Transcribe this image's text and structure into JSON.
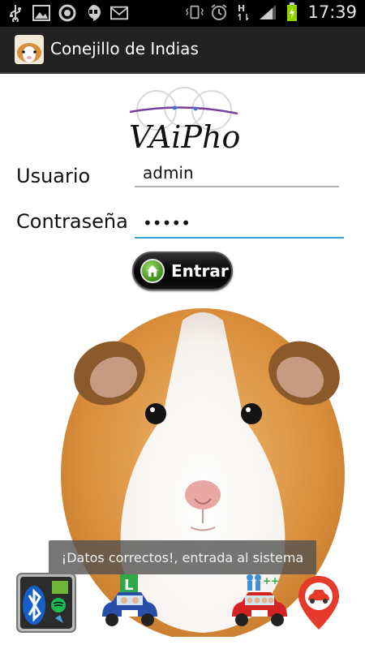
{
  "status_bar": {
    "time": "17:39",
    "icons": [
      "usb-icon",
      "picture-icon",
      "firefox-icon",
      "hangouts-icon",
      "gmail-icon",
      "vibrate-icon",
      "alarm-icon",
      "data-h-icon",
      "signal-icon",
      "battery-charging-icon"
    ]
  },
  "action_bar": {
    "title": "Conejillo de Indias",
    "icon": "guinea-pig-app-icon"
  },
  "logo": {
    "text": "VAiPho"
  },
  "form": {
    "user_label": "Usuario",
    "user_value": "admin",
    "password_label": "Contraseña",
    "password_value": "•••••"
  },
  "button": {
    "label": "Entrar",
    "icon": "home-icon"
  },
  "toast": {
    "message": "¡Datos correctos!, entrada al sistema"
  },
  "bottom_icons": [
    "bluetooth-apps-icon",
    "driving-school-car-icon",
    "carpool-car-icon",
    "car-location-pin-icon"
  ],
  "colors": {
    "status_bar_bg": "#000000",
    "action_bar_bg": "#222222",
    "focus_line": "#33a3d4",
    "button_bg": "#000000",
    "home_icon_green": "#3e8e1a",
    "pin_red": "#e53a2a"
  }
}
